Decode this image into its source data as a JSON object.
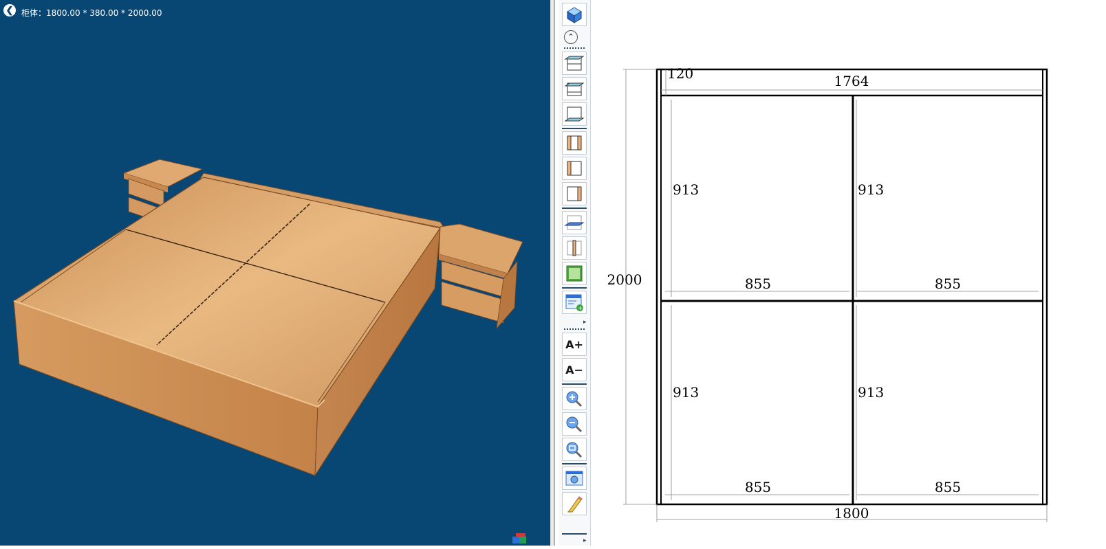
{
  "viewport": {
    "cabinet_dims_label": "柜体：1800.00 * 380.00 * 2000.00",
    "background_color": "#084674",
    "wood_color": "#d9a06a"
  },
  "toolbar": {
    "buttons": [
      {
        "icon": "cube-view-icon"
      },
      {
        "icon": "shelf-top-icon"
      },
      {
        "icon": "shelf-middle-icon"
      },
      {
        "icon": "shelf-bottom-icon"
      },
      {
        "icon": "side-panel-both-icon"
      },
      {
        "icon": "side-panel-left-icon"
      },
      {
        "icon": "side-panel-right-icon"
      },
      {
        "icon": "horizontal-panel-icon"
      },
      {
        "icon": "vertical-divider-icon"
      },
      {
        "icon": "door-panel-icon"
      },
      {
        "icon": "add-component-icon"
      },
      {
        "icon": "font-increase-icon",
        "text": "A+"
      },
      {
        "icon": "font-decrease-icon",
        "text": "A−"
      },
      {
        "icon": "zoom-in-icon"
      },
      {
        "icon": "zoom-out-icon"
      },
      {
        "icon": "zoom-fit-icon"
      },
      {
        "icon": "screenshot-icon"
      },
      {
        "icon": "edit-pencil-icon"
      }
    ]
  },
  "drawing": {
    "overall_width": "1800",
    "overall_height": "2000",
    "inner_width": "1764",
    "top_rail": "120",
    "cells": {
      "tl_height": "913",
      "tr_height": "913",
      "bl_height": "913",
      "br_height": "913",
      "tl_width": "855",
      "tr_width": "855",
      "bl_width": "855",
      "br_width": "855"
    }
  }
}
